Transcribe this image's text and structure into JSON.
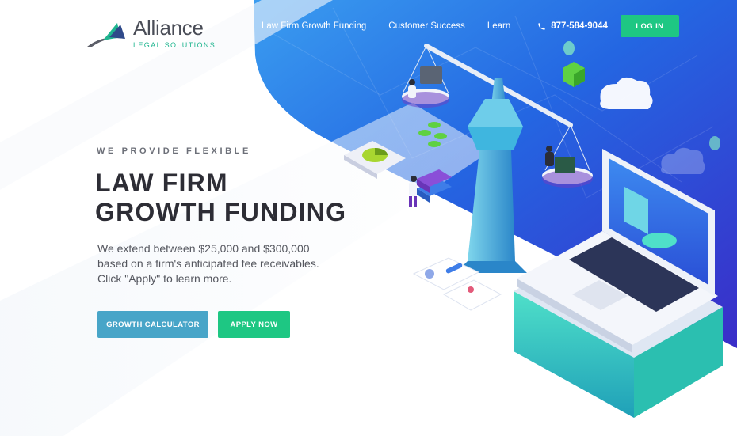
{
  "brand": {
    "name": "Alliance",
    "tagline": "LEGAL SOLUTIONS",
    "colors": {
      "primary_blue": "#1e6fe0",
      "accent_green": "#1ec783",
      "secondary_blue": "#48a5c8",
      "teal": "#2bbfb0"
    }
  },
  "nav": {
    "links": [
      {
        "label": "Law Firm Growth Funding"
      },
      {
        "label": "Customer Success"
      },
      {
        "label": "Learn"
      }
    ],
    "phone": {
      "icon": "phone-icon",
      "number": "877-584-9044"
    },
    "login_label": "LOG IN"
  },
  "hero": {
    "eyebrow": "WE PROVIDE FLEXIBLE",
    "headline_line1": "LAW FIRM",
    "headline_line2": "GROWTH FUNDING",
    "body_line1": "We extend between $25,000 and $300,000",
    "body_line2": "based on a firm's anticipated fee receivables.",
    "body_line3": "Click \"Apply\" to learn more.",
    "calculator_label": "GROWTH CALCULATOR",
    "apply_label": "APPLY NOW"
  },
  "illustration": {
    "icons": [
      "scales-of-justice-icon",
      "laptop-icon",
      "cloud-icon",
      "books-icon",
      "pie-chart-icon",
      "people-icon",
      "cube-icon",
      "coins-icon"
    ]
  }
}
